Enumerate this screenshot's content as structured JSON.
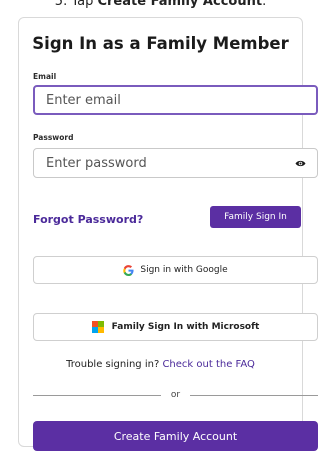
{
  "instruction": {
    "prefix": "5. Tap ",
    "emphasis": "Create Family Account",
    "suffix": "."
  },
  "title": "Sign In as a Family Member",
  "email": {
    "label": "Email",
    "placeholder": "Enter email"
  },
  "password": {
    "label": "Password",
    "placeholder": "Enter password",
    "icon": "eye-icon"
  },
  "forgot_password": "Forgot Password?",
  "family_sign_in": "Family Sign In",
  "google_button": {
    "label": "Sign in with Google",
    "icon": "google-icon"
  },
  "microsoft_button": {
    "label": "Family Sign In with Microsoft",
    "icon": "microsoft-icon"
  },
  "trouble": {
    "text": "Trouble signing in?",
    "link": "Check out the FAQ"
  },
  "divider_text": "or",
  "create_account": "Create Family Account",
  "colors": {
    "accent": "#5b2fa3",
    "link": "#4b2a9a",
    "focus_border": "#7a5bbd"
  }
}
